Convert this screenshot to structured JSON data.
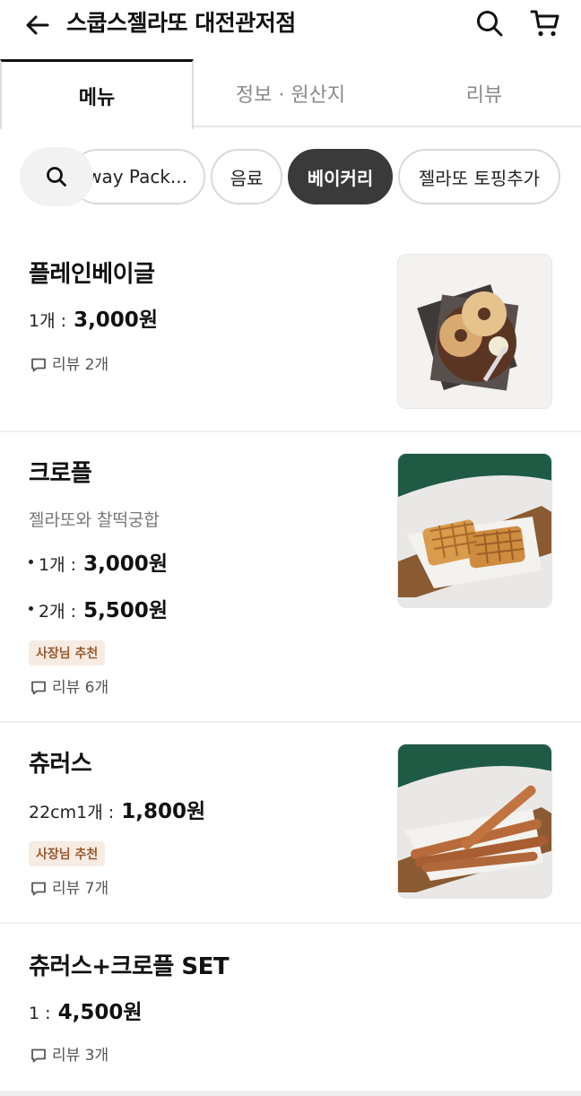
{
  "header": {
    "title": "스쿱스젤라또 대전관저점",
    "back_icon": "arrow-left-icon",
    "search_icon": "search-icon",
    "cart_icon": "cart-icon"
  },
  "tabs": [
    {
      "label": "메뉴",
      "active": true
    },
    {
      "label": "정보 · 원산지",
      "active": false
    },
    {
      "label": "리뷰",
      "active": false
    }
  ],
  "categories": {
    "items": [
      "way Pack...",
      "음료",
      "베이커리",
      "젤라또 토핑추가"
    ],
    "selected": "베이커리"
  },
  "menu": [
    {
      "name": "플레인베이글",
      "prices": [
        {
          "label": "1개 :",
          "amount": "3,000원"
        }
      ],
      "review": "리뷰 2개"
    },
    {
      "name": "크로플",
      "desc": "젤라또와 찰떡궁합",
      "prices": [
        {
          "label": "1개 :",
          "amount": "3,000원"
        },
        {
          "label": "2개 :",
          "amount": "5,500원"
        }
      ],
      "badge": "사장님 추천",
      "review": "리뷰 6개"
    },
    {
      "name": "츄러스",
      "prices": [
        {
          "label": "22cm1개 :",
          "amount": "1,800원"
        }
      ],
      "badge": "사장님 추천",
      "review": "리뷰 7개"
    },
    {
      "name": "츄러스+크로플 SET",
      "prices": [
        {
          "label": "1 :",
          "amount": "4,500원"
        }
      ],
      "review": "리뷰 3개"
    }
  ],
  "colors": {
    "accent_dark": "#3a3a3a",
    "badge_bg": "#f6ece4",
    "badge_text": "#9a5a2e",
    "thumb_green": "#1f5a45"
  }
}
